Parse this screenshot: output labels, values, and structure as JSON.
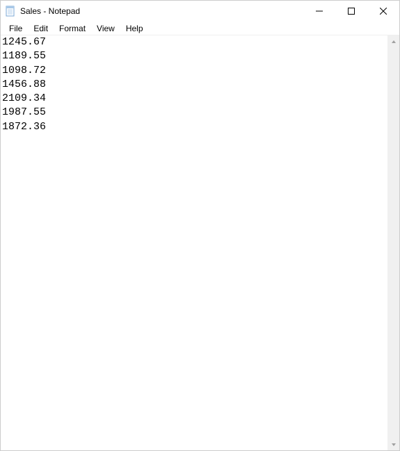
{
  "window": {
    "title": "Sales - Notepad"
  },
  "menu": {
    "file": "File",
    "edit": "Edit",
    "format": "Format",
    "view": "View",
    "help": "Help"
  },
  "document": {
    "lines": [
      "1245.67",
      "1189.55",
      "1098.72",
      "1456.88",
      "2109.34",
      "1987.55",
      "1872.36"
    ]
  }
}
